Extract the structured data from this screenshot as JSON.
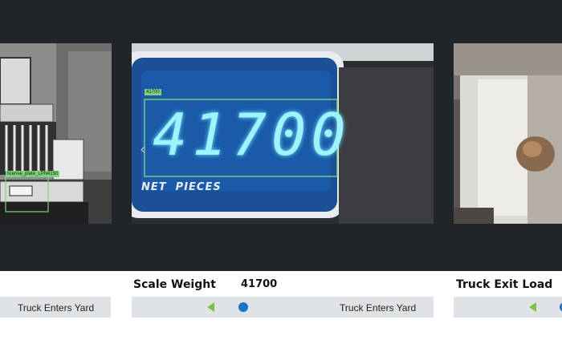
{
  "slides": {
    "left": {
      "detection_label": "license_plate_LPN4150",
      "plate_text": "LPN4150"
    },
    "center": {
      "detection_label": "41700",
      "display_digits": "41700",
      "display_caption": "NET  PIECES"
    }
  },
  "navigation": {
    "prev_glyph": "‹"
  },
  "captions": {
    "center": {
      "title": "Scale Weight",
      "value": "41700"
    },
    "right": {
      "title": "Truck Exit Load"
    }
  },
  "timelines": {
    "left": {
      "event_label": "Truck Enters Yard"
    },
    "center": {
      "event_label": "Truck Enters Yard"
    }
  },
  "colors": {
    "dark_background": "#212529",
    "detection_box": "#7fd17f",
    "lcd_digits": "#9ff3ff",
    "timeline_bar": "#dfe3e6",
    "timeline_arrow": "#7ec142",
    "timeline_marker": "#1a74c7"
  }
}
